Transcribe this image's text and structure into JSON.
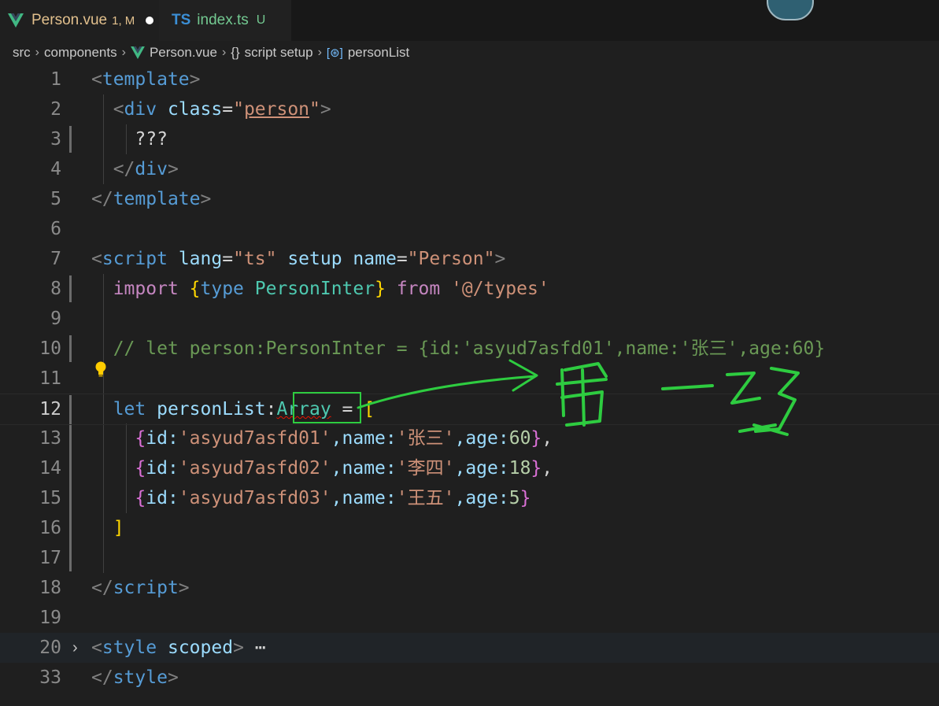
{
  "tabs": [
    {
      "name": "Person.vue",
      "meta": "1, M"
    },
    {
      "badge": "TS",
      "name": "index.ts",
      "meta": "U"
    }
  ],
  "breadcrumb": {
    "parts": [
      "src",
      "components",
      "Person.vue",
      "script setup",
      "personList"
    ],
    "braces": "{}"
  },
  "line_numbers": [
    "1",
    "2",
    "3",
    "4",
    "5",
    "6",
    "7",
    "8",
    "9",
    "10",
    "11",
    "12",
    "13",
    "14",
    "15",
    "16",
    "17",
    "18",
    "19",
    "20",
    "33"
  ],
  "code": {
    "l1": {
      "open": "<",
      "tag": "template",
      "close": ">"
    },
    "l2": {
      "open": "<",
      "tag": "div",
      "attr": "class",
      "eq": "=",
      "q1": "\"",
      "val": "person",
      "q2": "\"",
      "close": ">"
    },
    "l3": {
      "text": "???"
    },
    "l4": {
      "open": "</",
      "tag": "div",
      "close": ">"
    },
    "l5": {
      "open": "</",
      "tag": "template",
      "close": ">"
    },
    "l7": {
      "open": "<",
      "tag": "script",
      "attr1": "lang",
      "eq1": "=",
      "val1": "\"ts\"",
      "attr2": "setup",
      "attr3": "name",
      "eq3": "=",
      "val3": "\"Person\"",
      "close": ">"
    },
    "l8": {
      "kw": "import",
      "b1": "{",
      "type_kw": "type",
      "type": "PersonInter",
      "b2": "}",
      "from": "from",
      "path": "'@/types'"
    },
    "l10": {
      "comment": "// let person:PersonInter = {id:'asyud7asfd01',name:'张三',age:60}"
    },
    "l12": {
      "let": "let",
      "var": "personList",
      "colon": ":",
      "type": "Array",
      "eq": " = ",
      "br": "["
    },
    "l13": {
      "ob": "{",
      "body": "id:",
      "id": "'asyud7asfd01'",
      "n": ",name:",
      "name": "'张三'",
      "a": ",age:",
      "age": "60",
      "cb": "}",
      "comma": ","
    },
    "l14": {
      "ob": "{",
      "body": "id:",
      "id": "'asyud7asfd02'",
      "n": ",name:",
      "name": "'李四'",
      "a": ",age:",
      "age": "18",
      "cb": "}",
      "comma": ","
    },
    "l15": {
      "ob": "{",
      "body": "id:",
      "id": "'asyud7asfd03'",
      "n": ",name:",
      "name": "'王五'",
      "a": ",age:",
      "age": "5",
      "cb": "}"
    },
    "l16": {
      "br": "]"
    },
    "l18": {
      "open": "</",
      "tag": "script",
      "close": ">"
    },
    "l20": {
      "open": "<",
      "tag": "style",
      "attr": "scoped",
      "close": ">",
      "ellipsis": "⋯"
    },
    "l33": {
      "open": "</",
      "tag": "style",
      "close": ">"
    }
  },
  "icons": {
    "vue": "vue-logo-icon",
    "bulb": "lightbulb-icon",
    "symbol": "variable-symbol-icon",
    "chevron": "chevron-right-icon"
  },
  "colors": {
    "modified": "#e2c08d",
    "untracked": "#73c991",
    "annotation": "#2ecc40"
  }
}
